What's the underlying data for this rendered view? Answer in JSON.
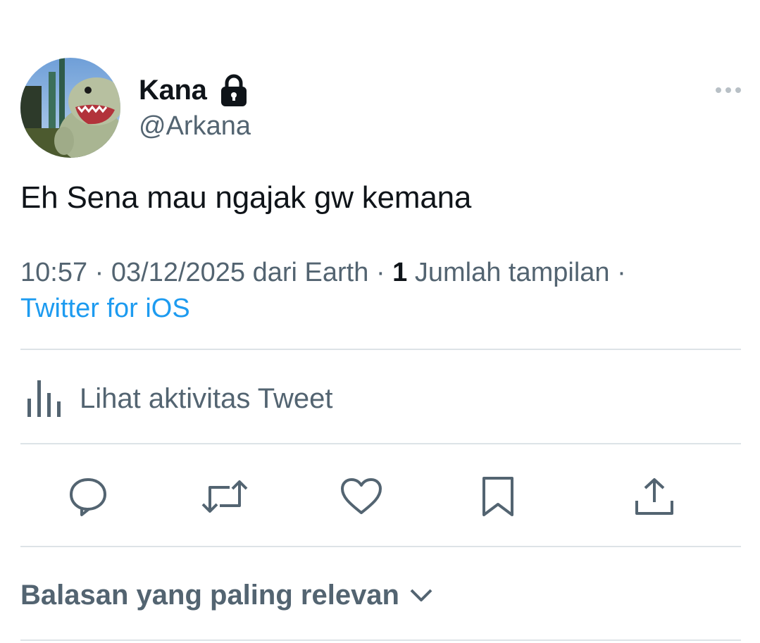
{
  "tweet": {
    "display_name": "Kana",
    "handle": "@Arkana",
    "text": "Eh Sena mau ngajak gw kemana",
    "time": "10:57",
    "date": "03/12/2025",
    "location": "dari Earth",
    "views_count": "1",
    "views_label": "Jumlah tampilan",
    "source": "Twitter for iOS",
    "separator": "·"
  },
  "icons": {
    "lock": "lock-icon",
    "more": "more-icon",
    "activity": "bar-chart-icon",
    "reply": "reply-icon",
    "retweet": "retweet-icon",
    "like": "heart-icon",
    "bookmark": "bookmark-icon",
    "share": "share-icon",
    "chevron": "chevron-down-icon"
  },
  "activity": {
    "label": "Lihat aktivitas Tweet"
  },
  "replies": {
    "sort_label": "Balasan yang paling relevan"
  },
  "colors": {
    "text_primary": "#0f1419",
    "text_secondary": "#536471",
    "link": "#1d9bf0",
    "divider": "#dde3e7"
  }
}
